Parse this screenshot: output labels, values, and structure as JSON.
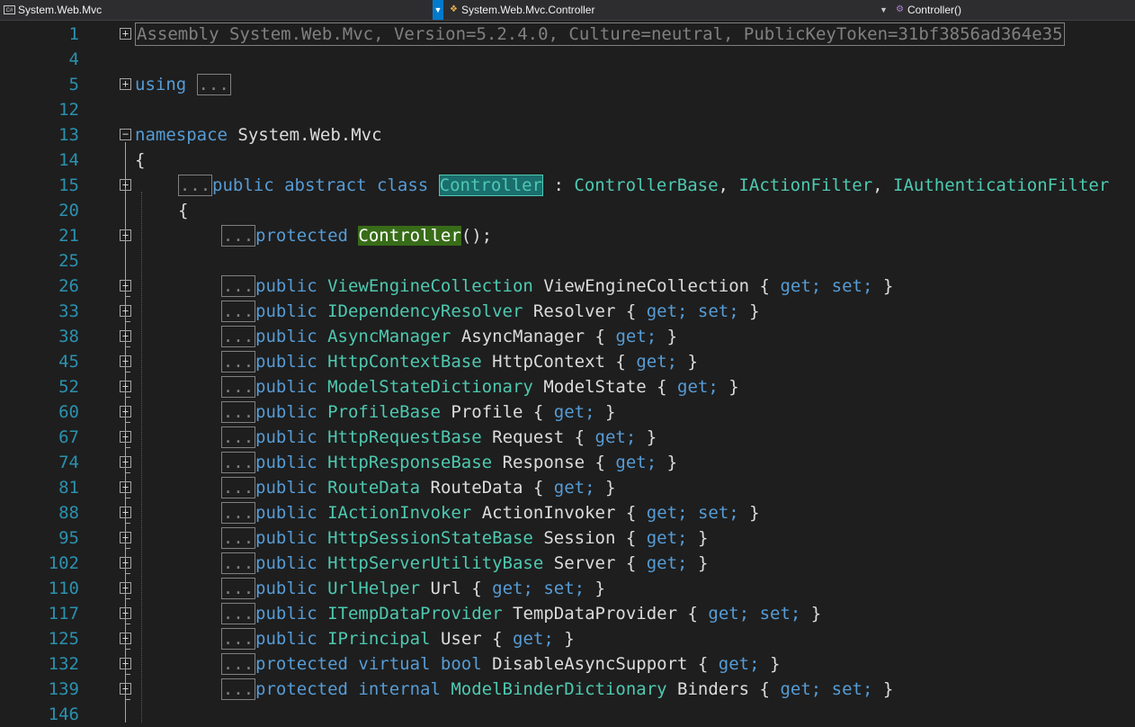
{
  "navbar": {
    "project": "System.Web.Mvc",
    "type": "System.Web.Mvc.Controller",
    "member": "Controller()"
  },
  "lines": [
    {
      "num": "1"
    },
    {
      "num": "4"
    },
    {
      "num": "5"
    },
    {
      "num": "12"
    },
    {
      "num": "13"
    },
    {
      "num": "14"
    },
    {
      "num": "15"
    },
    {
      "num": "20"
    },
    {
      "num": "21"
    },
    {
      "num": "25"
    },
    {
      "num": "26"
    },
    {
      "num": "33"
    },
    {
      "num": "38"
    },
    {
      "num": "45"
    },
    {
      "num": "52"
    },
    {
      "num": "60"
    },
    {
      "num": "67"
    },
    {
      "num": "74"
    },
    {
      "num": "81"
    },
    {
      "num": "88"
    },
    {
      "num": "95"
    },
    {
      "num": "102"
    },
    {
      "num": "110"
    },
    {
      "num": "117"
    },
    {
      "num": "125"
    },
    {
      "num": "132"
    },
    {
      "num": "139"
    },
    {
      "num": "146"
    }
  ],
  "code": {
    "assembly": "Assembly System.Web.Mvc, Version=5.2.4.0, Culture=neutral, PublicKeyToken=31bf3856ad364e35",
    "using_kw": "using",
    "ellipsis": "...",
    "namespace_kw": "namespace",
    "namespace_name": "System.Web.Mvc",
    "open_brace": "{",
    "class_mods": "public abstract class",
    "class_name": "Controller",
    "class_colon": " : ",
    "class_base": "ControllerBase",
    "comma": ", ",
    "iface1": "IActionFilter",
    "iface2": "IAuthenticationFilter",
    "ctor_kw": "protected",
    "ctor_name": "Controller",
    "ctor_tail": "();",
    "members": [
      {
        "mods": "public",
        "type": "ViewEngineCollection",
        "name": "ViewEngineCollection",
        "acc": "get; set;"
      },
      {
        "mods": "public",
        "type": "IDependencyResolver",
        "name": "Resolver",
        "acc": "get; set;"
      },
      {
        "mods": "public",
        "type": "AsyncManager",
        "name": "AsyncManager",
        "acc": "get;"
      },
      {
        "mods": "public",
        "type": "HttpContextBase",
        "name": "HttpContext",
        "acc": "get;"
      },
      {
        "mods": "public",
        "type": "ModelStateDictionary",
        "name": "ModelState",
        "acc": "get;"
      },
      {
        "mods": "public",
        "type": "ProfileBase",
        "name": "Profile",
        "acc": "get;"
      },
      {
        "mods": "public",
        "type": "HttpRequestBase",
        "name": "Request",
        "acc": "get;"
      },
      {
        "mods": "public",
        "type": "HttpResponseBase",
        "name": "Response",
        "acc": "get;"
      },
      {
        "mods": "public",
        "type": "RouteData",
        "name": "RouteData",
        "acc": "get;"
      },
      {
        "mods": "public",
        "type": "IActionInvoker",
        "name": "ActionInvoker",
        "acc": "get; set;"
      },
      {
        "mods": "public",
        "type": "HttpSessionStateBase",
        "name": "Session",
        "acc": "get;"
      },
      {
        "mods": "public",
        "type": "HttpServerUtilityBase",
        "name": "Server",
        "acc": "get;"
      },
      {
        "mods": "public",
        "type": "UrlHelper",
        "name": "Url",
        "acc": "get; set;"
      },
      {
        "mods": "public",
        "type": "ITempDataProvider",
        "name": "TempDataProvider",
        "acc": "get; set;"
      },
      {
        "mods": "public",
        "type": "IPrincipal",
        "name": "User",
        "acc": "get;"
      },
      {
        "mods": "protected virtual bool",
        "type": "",
        "name": "DisableAsyncSupport",
        "acc": "get;"
      },
      {
        "mods": "protected internal",
        "type": "ModelBinderDictionary",
        "name": "Binders",
        "acc": "get; set;"
      }
    ]
  },
  "colors": {
    "background": "#1e1e1e",
    "line_number": "#2b91af",
    "keyword": "#569cd6",
    "type": "#4ec9b0",
    "text": "#dcdcdc",
    "highlight_reference": "#1a6e6e",
    "highlight_definition": "#386c18"
  },
  "icons": {
    "project": "csharp-project-icon",
    "type": "class-icon",
    "member": "method-icon",
    "dropdown": "chevron-down-icon"
  }
}
